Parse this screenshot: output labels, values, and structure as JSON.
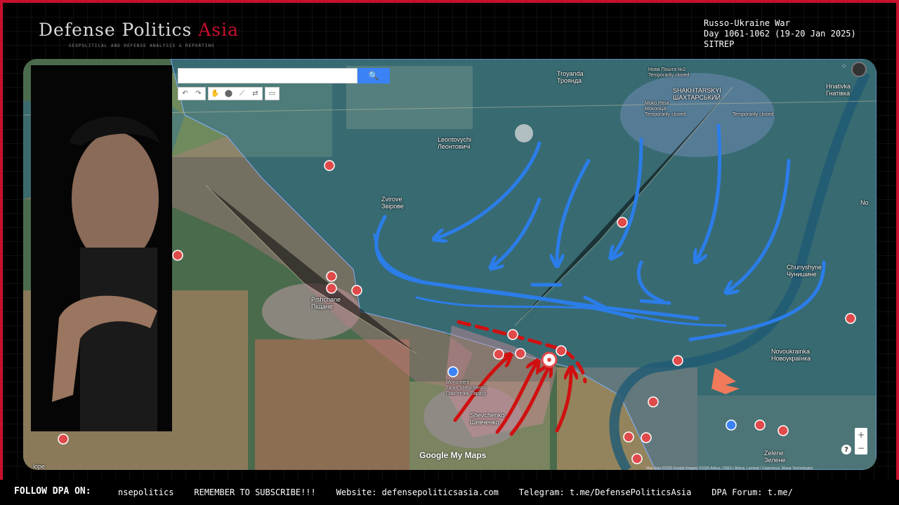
{
  "brand": {
    "name_part1": "Defense Politics",
    "name_part2": "Asia",
    "tagline": "GEOPOLITICAL AND DEFENSE ANALYSIS & REPORTING",
    "accent": "#c8102e"
  },
  "sitrep": {
    "line1": "Russo-Ukraine War",
    "line2": "Day 1061-1062 (19-20 Jan 2025)",
    "line3": "SITREP"
  },
  "map": {
    "search_placeholder": "",
    "tools": [
      "undo-icon",
      "redo-icon",
      "hand-icon",
      "marker-icon",
      "draw-line-icon",
      "route-icon",
      "measure-icon"
    ],
    "labels": {
      "troyanda": "Troyanda\nТроянда",
      "nova_poshta": "Нова Пошта №2\nTemporarily closed",
      "shakhtarskyi": "SHAKHTARSKYI\nШАХТАРСЬКИЙ",
      "moko_pitsa": "Moko Pitsa\nМокопіца\nTemporarily closed",
      "temporarily_closed": "Temporarily closed",
      "hnativka": "Hnativka\nГнатівка",
      "leontovychi": "Leontovychi\nЛеонтовичі",
      "zvirove": "Zvirove\nЗвірове",
      "pishchane": "Pishchane\nПіщане",
      "chunyshyne": "Chunyshyne\nЧунишине",
      "novoukrainka": "Novoukrainka\nНовоукраїнка",
      "monument": "Monument\nTaras Shevchenko\nПам'ятник Тарасу",
      "shevchenko": "Shevchenko\nШевченко",
      "zelene": "Zelene\nЗелене",
      "no": "No",
      "lope": "lope"
    },
    "attribution": "Map data ©2025 Google Imagery ©2025 Airbus, CNES / Airbus, Landsat / Copernicus, Maxar Technologies",
    "logo": "Google My Maps",
    "zoom_in": "+",
    "zoom_out": "−",
    "help": "?"
  },
  "ticker": {
    "follow_label": "FOLLOW DPA ON:",
    "text": "nsepolitics    REMEMBER TO SUBSCRIBE!!!    Website: defensepoliticsasia.com    Telegram: t.me/DefensePoliticsAsia    DPA Forum: t.me/"
  },
  "colors": {
    "ukraine_area": "#1e6aa8",
    "russia_area": "#a85a6a",
    "arrow_blue": "#2b7de9",
    "arrow_red": "#d01010",
    "marker_red": "#e04a4a",
    "marker_blue": "#3b82f6"
  }
}
